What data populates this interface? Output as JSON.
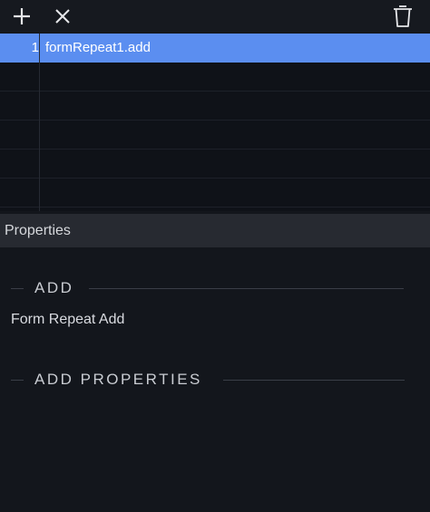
{
  "toolbar": {
    "add_icon": "plus-icon",
    "remove_icon": "x-icon",
    "delete_icon": "trash-icon"
  },
  "list": {
    "rows": [
      {
        "num": "1",
        "value": "formRepeat1.add",
        "selected": true
      }
    ]
  },
  "properties": {
    "header": "Properties",
    "section_title": "ADD",
    "description": "Form Repeat Add",
    "subsection_title": "ADD PROPERTIES"
  },
  "colors": {
    "selection": "#5b8ef0",
    "background": "#13161c",
    "header_bg": "#272a31"
  }
}
